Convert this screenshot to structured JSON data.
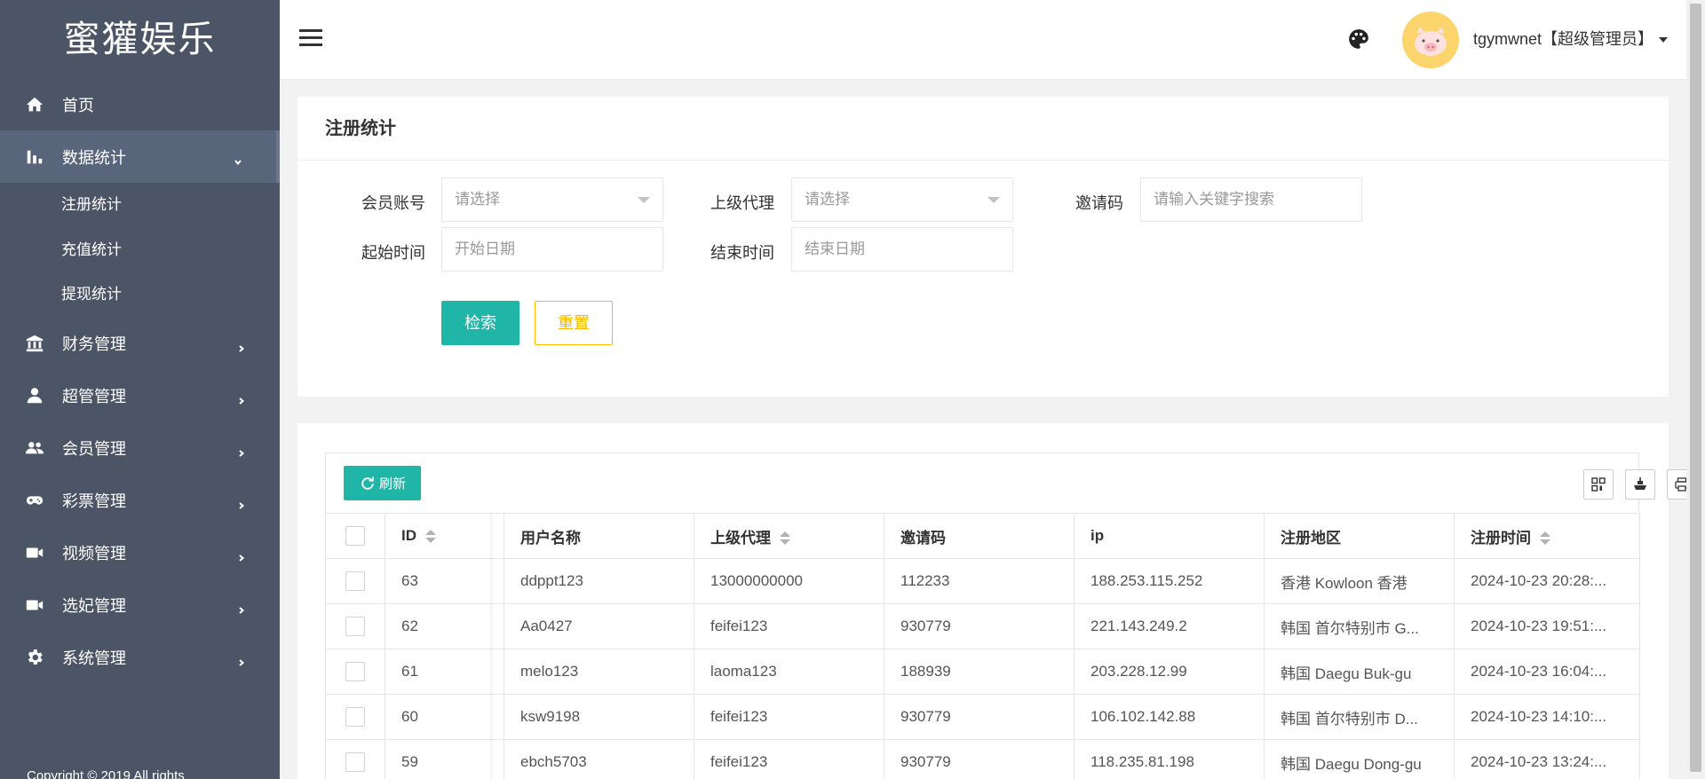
{
  "app": {
    "logo": "蜜獾娱乐",
    "copyright": "Copyright © 2019  All rights"
  },
  "sidebar": {
    "items": [
      {
        "label": "首页",
        "icon": "home-icon"
      },
      {
        "label": "数据统计",
        "icon": "bar-chart-icon",
        "expanded": true,
        "children": [
          {
            "label": "注册统计"
          },
          {
            "label": "充值统计"
          },
          {
            "label": "提现统计"
          }
        ]
      },
      {
        "label": "财务管理",
        "icon": "bank-icon"
      },
      {
        "label": "超管管理",
        "icon": "user-icon"
      },
      {
        "label": "会员管理",
        "icon": "users-icon"
      },
      {
        "label": "彩票管理",
        "icon": "gamepad-icon"
      },
      {
        "label": "视频管理",
        "icon": "video-icon"
      },
      {
        "label": "选妃管理",
        "icon": "video-icon"
      },
      {
        "label": "系统管理",
        "icon": "gear-icon"
      }
    ]
  },
  "header": {
    "username": "tgymwnet【超级管理员】"
  },
  "search_panel": {
    "title": "注册统计",
    "fields": {
      "member_account": {
        "label": "会员账号",
        "placeholder": "请选择"
      },
      "parent_agent": {
        "label": "上级代理",
        "placeholder": "请选择"
      },
      "invite_code": {
        "label": "邀请码",
        "placeholder": "请输入关键字搜索"
      },
      "start_time": {
        "label": "起始时间",
        "placeholder": "开始日期"
      },
      "end_time": {
        "label": "结束时间",
        "placeholder": "结束日期"
      }
    },
    "search_button": "检索",
    "reset_button": "重置"
  },
  "table": {
    "refresh_button": "刷新",
    "columns": [
      "ID",
      "用户名称",
      "上级代理",
      "邀请码",
      "ip",
      "注册地区",
      "注册时间"
    ],
    "rows": [
      {
        "id": "63",
        "username": "ddppt123",
        "parent": "13000000000",
        "code": "112233",
        "ip": "188.253.115.252",
        "region": "香港 Kowloon 香港",
        "time": "2024-10-23 20:28:..."
      },
      {
        "id": "62",
        "username": "Aa0427",
        "parent": "feifei123",
        "code": "930779",
        "ip": "221.143.249.2",
        "region": "韩国 首尔特别市 G...",
        "time": "2024-10-23 19:51:..."
      },
      {
        "id": "61",
        "username": "melo123",
        "parent": "laoma123",
        "code": "188939",
        "ip": "203.228.12.99",
        "region": "韩国 Daegu Buk-gu",
        "time": "2024-10-23 16:04:..."
      },
      {
        "id": "60",
        "username": "ksw9198",
        "parent": "feifei123",
        "code": "930779",
        "ip": "106.102.142.88",
        "region": "韩国 首尔特别市 D...",
        "time": "2024-10-23 14:10:..."
      },
      {
        "id": "59",
        "username": "ebch5703",
        "parent": "feifei123",
        "code": "930779",
        "ip": "118.235.81.198",
        "region": "韩国 Daegu Dong-gu",
        "time": "2024-10-23 13:24:..."
      }
    ]
  },
  "colors": {
    "sidebar_bg": "#4b5566",
    "primary": "#1fb5a7",
    "warning": "#ffb800"
  }
}
